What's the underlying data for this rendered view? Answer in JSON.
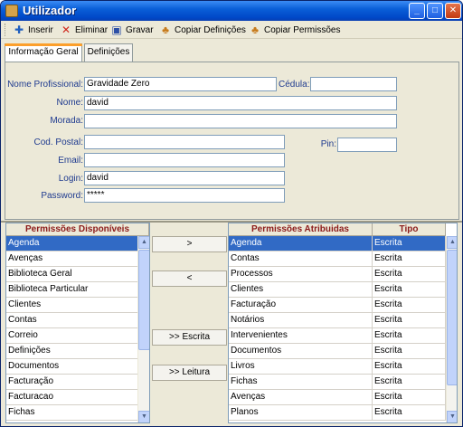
{
  "window": {
    "title": "Utilizador",
    "controls": [
      "_",
      "□",
      "✕"
    ]
  },
  "toolbar": {
    "items": [
      {
        "label": "Inserir",
        "icon": "plus-icon",
        "glyph": "✚",
        "color": "#1f5fbf"
      },
      {
        "label": "Eliminar",
        "icon": "delete-icon",
        "glyph": "✕",
        "color": "#d0281c"
      },
      {
        "label": "Gravar",
        "icon": "save-disk-icon",
        "glyph": "▣",
        "color": "#2c4fa6"
      },
      {
        "label": "Copiar Definições",
        "icon": "copy-users-icon",
        "glyph": "♣",
        "color": "#c77a1a"
      },
      {
        "label": "Copiar Permissões",
        "icon": "copy-users-icon",
        "glyph": "♣",
        "color": "#c77a1a"
      }
    ]
  },
  "tabs": [
    {
      "label": "Informação Geral",
      "active": true
    },
    {
      "label": "Definições",
      "active": false
    }
  ],
  "form": {
    "nome_profissional": {
      "label": "Nome Profissional:",
      "value": "Gravidade Zero"
    },
    "cedula": {
      "label": "Cédula:",
      "value": ""
    },
    "nome": {
      "label": "Nome:",
      "value": "david"
    },
    "morada": {
      "label": "Morada:",
      "value": ""
    },
    "cod_postal": {
      "label": "Cod. Postal:",
      "value": ""
    },
    "pin": {
      "label": "Pin:",
      "value": ""
    },
    "email": {
      "label": "Email:",
      "value": ""
    },
    "login": {
      "label": "Login:",
      "value": "david"
    },
    "password": {
      "label": "Password:",
      "value": "*****"
    }
  },
  "available": {
    "header": "Permissões Disponíveis",
    "items": [
      "Agenda",
      "Avenças",
      "Biblioteca Geral",
      "Biblioteca Particular",
      "Clientes",
      "Contas",
      "Correio",
      "Definições",
      "Documentos",
      "Facturação",
      "Facturacao",
      "Fichas"
    ],
    "selected_index": 0
  },
  "transfer": {
    "add": ">",
    "remove": "<",
    "write": ">> Escrita",
    "read": ">> Leitura"
  },
  "assigned": {
    "header_name": "Permissões Atribuidas",
    "header_type": "Tipo",
    "rows": [
      {
        "name": "Agenda",
        "type": "Escrita"
      },
      {
        "name": "Contas",
        "type": "Escrita"
      },
      {
        "name": "Processos",
        "type": "Escrita"
      },
      {
        "name": "Clientes",
        "type": "Escrita"
      },
      {
        "name": "Facturação",
        "type": "Escrita"
      },
      {
        "name": "Notários",
        "type": "Escrita"
      },
      {
        "name": "Intervenientes",
        "type": "Escrita"
      },
      {
        "name": "Documentos",
        "type": "Escrita"
      },
      {
        "name": "Livros",
        "type": "Escrita"
      },
      {
        "name": "Fichas",
        "type": "Escrita"
      },
      {
        "name": "Avenças",
        "type": "Escrita"
      },
      {
        "name": "Planos",
        "type": "Escrita"
      }
    ],
    "selected_index": 0
  },
  "colors": {
    "selection": "#316ac5",
    "header_text": "#8b1a1a",
    "label_text": "#1e3a8f"
  }
}
